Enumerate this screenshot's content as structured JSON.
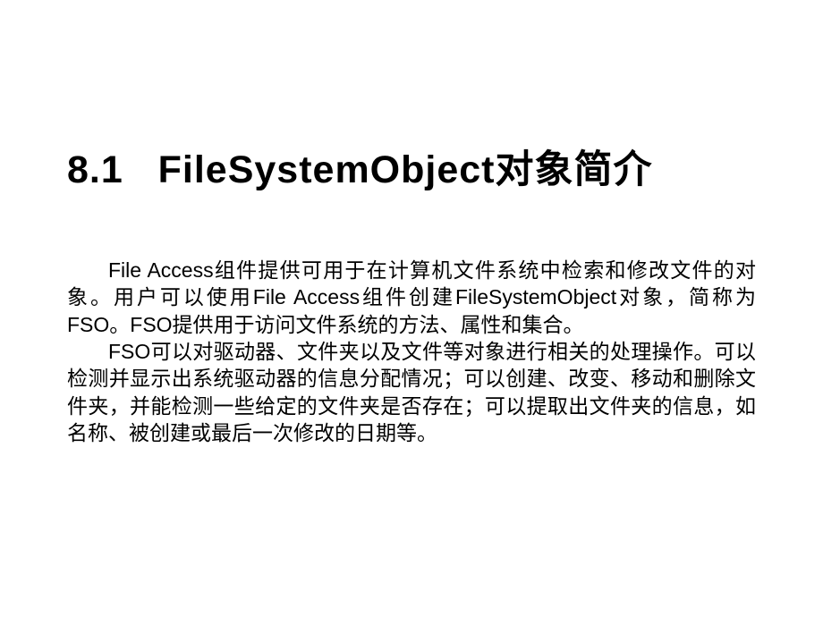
{
  "section": {
    "number": "8.1",
    "title": "FileSystemObject对象简介"
  },
  "paragraphs": [
    "File Access组件提供可用于在计算机文件系统中检索和修改文件的对象。用户可以使用File Access组件创建FileSystemObject对象，简称为FSO。FSO提供用于访问文件系统的方法、属性和集合。",
    "FSO可以对驱动器、文件夹以及文件等对象进行相关的处理操作。可以检测并显示出系统驱动器的信息分配情况；可以创建、改变、移动和删除文件夹，并能检测一些给定的文件夹是否存在；可以提取出文件夹的信息，如名称、被创建或最后一次修改的日期等。"
  ]
}
